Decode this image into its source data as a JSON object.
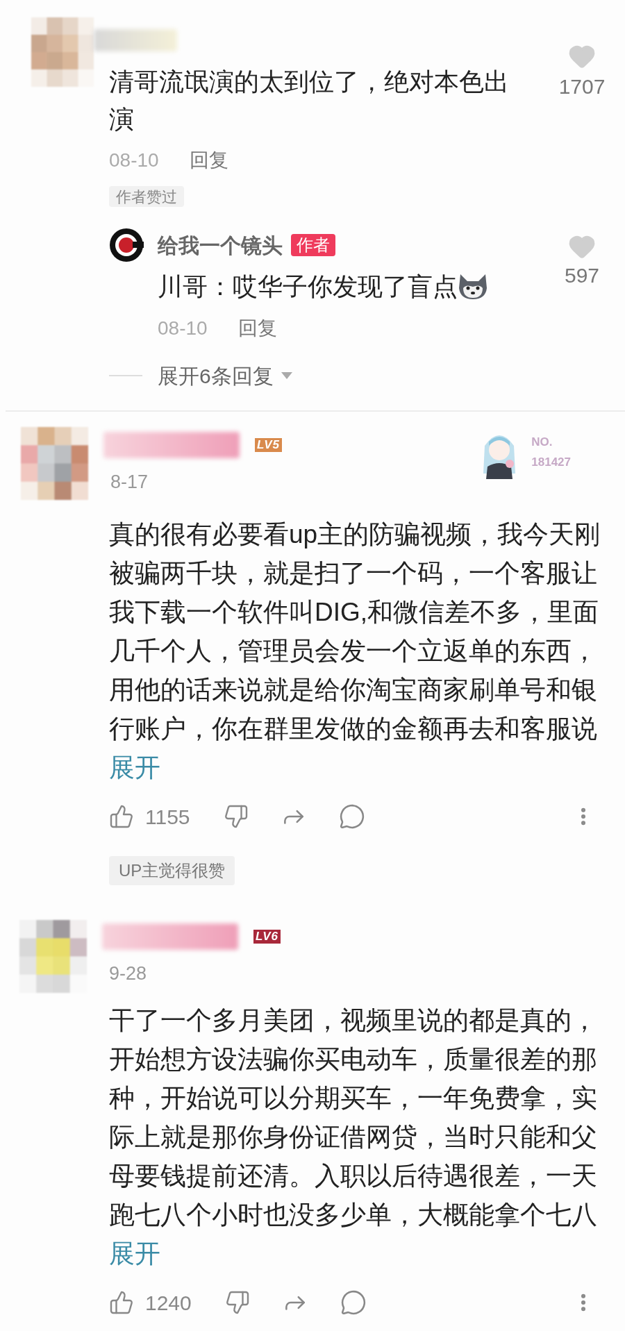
{
  "top_comment": {
    "text": "清哥流氓演的太到位了，绝对本色出演",
    "likes": "1707",
    "date": "08-10",
    "reply_label": "回复",
    "badge": "作者赞过",
    "replies": [
      {
        "author": "给我一个镜头",
        "author_badge": "作者",
        "text": "川哥：哎华子你发现了盲点",
        "likes": "597",
        "date": "08-10",
        "reply_label": "回复"
      }
    ],
    "expand_label": "展开6条回复"
  },
  "comments": [
    {
      "level_badge": {
        "text": "LV5",
        "color": "#d98a4c"
      },
      "date": "8-17",
      "fan_badge": {
        "label": "NO.",
        "number": "181427"
      },
      "text": "真的很有必要看up主的防骗视频，我今天刚被骗两千块，就是扫了一个码，一个客服让我下载一个软件叫DIG,和微信差不多，里面几千个人，管理员会发一个立返单的东西，用他的话来说就是给你淘宝商家刷单号和银行账户，你在群里发做的金额再去和客服说",
      "more": "展开",
      "likes": "1155",
      "up_badge": "UP主觉得很赞"
    },
    {
      "level_badge": {
        "text": "LV6",
        "color": "#a8283a"
      },
      "date": "9-28",
      "text": "干了一个多月美团，视频里说的都是真的，开始想方设法骗你买电动车，质量很差的那种，开始说可以分期买车，一年免费拿，实际上就是那你身份证借网贷，当时只能和父母要钱提前还清。入职以后待遇很差，一天跑七八个小时也没多少单，大概能拿个七八",
      "more": "展开",
      "likes": "1240"
    }
  ]
}
